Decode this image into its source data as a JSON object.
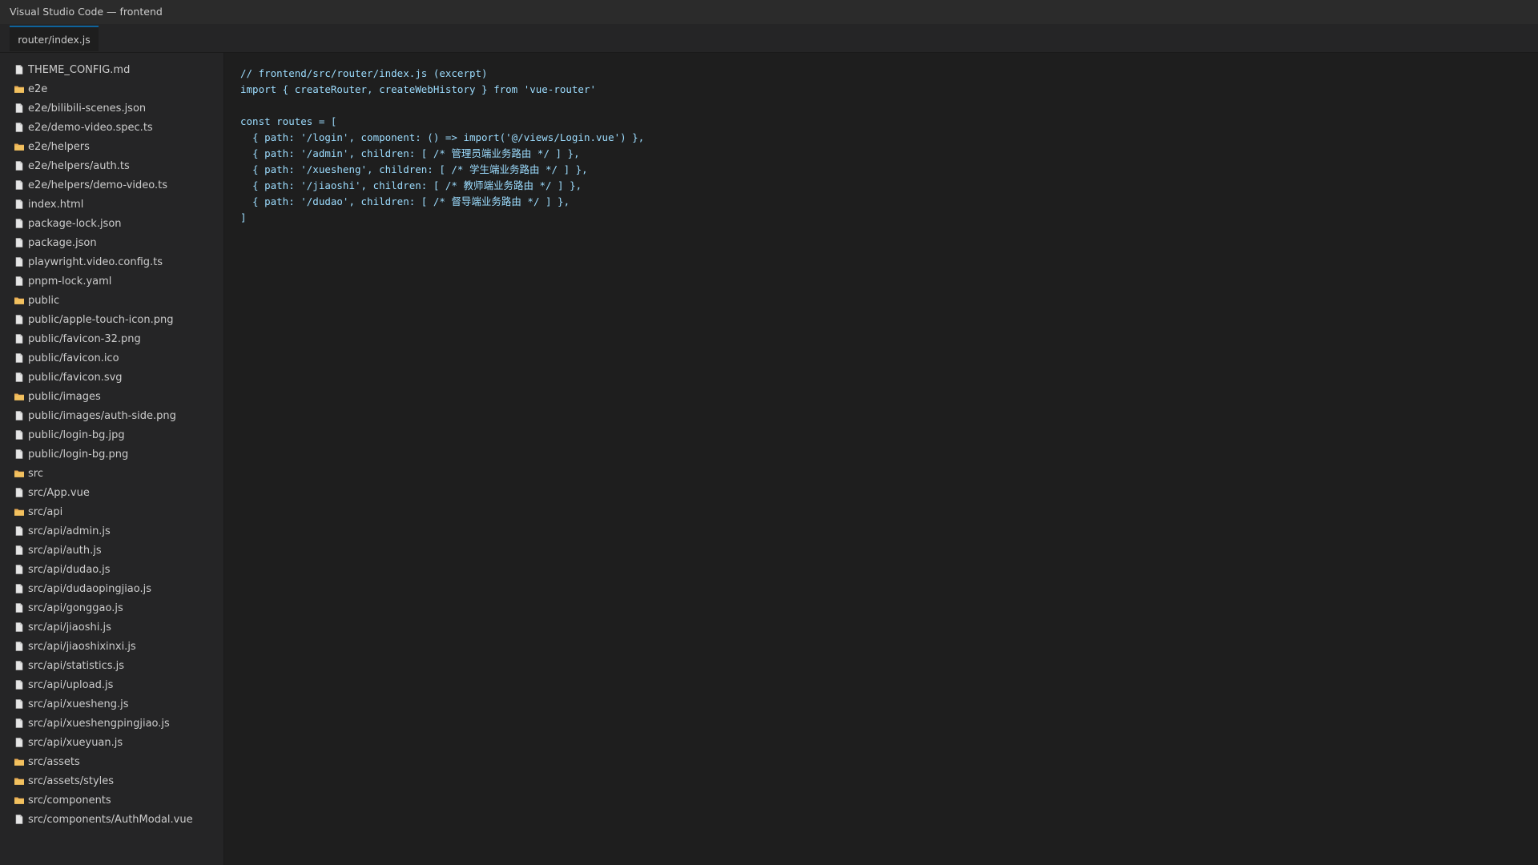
{
  "window": {
    "title": "Visual Studio Code — frontend"
  },
  "tabs": [
    {
      "label": "router/index.js",
      "active": true
    }
  ],
  "explorer": {
    "items": [
      {
        "label": "THEME_CONFIG.md",
        "type": "file"
      },
      {
        "label": "e2e",
        "type": "folder"
      },
      {
        "label": "e2e/bilibili-scenes.json",
        "type": "file"
      },
      {
        "label": "e2e/demo-video.spec.ts",
        "type": "file"
      },
      {
        "label": "e2e/helpers",
        "type": "folder"
      },
      {
        "label": "e2e/helpers/auth.ts",
        "type": "file"
      },
      {
        "label": "e2e/helpers/demo-video.ts",
        "type": "file"
      },
      {
        "label": "index.html",
        "type": "file"
      },
      {
        "label": "package-lock.json",
        "type": "file"
      },
      {
        "label": "package.json",
        "type": "file"
      },
      {
        "label": "playwright.video.config.ts",
        "type": "file"
      },
      {
        "label": "pnpm-lock.yaml",
        "type": "file"
      },
      {
        "label": "public",
        "type": "folder"
      },
      {
        "label": "public/apple-touch-icon.png",
        "type": "file"
      },
      {
        "label": "public/favicon-32.png",
        "type": "file"
      },
      {
        "label": "public/favicon.ico",
        "type": "file"
      },
      {
        "label": "public/favicon.svg",
        "type": "file"
      },
      {
        "label": "public/images",
        "type": "folder"
      },
      {
        "label": "public/images/auth-side.png",
        "type": "file"
      },
      {
        "label": "public/login-bg.jpg",
        "type": "file"
      },
      {
        "label": "public/login-bg.png",
        "type": "file"
      },
      {
        "label": "src",
        "type": "folder"
      },
      {
        "label": "src/App.vue",
        "type": "file"
      },
      {
        "label": "src/api",
        "type": "folder"
      },
      {
        "label": "src/api/admin.js",
        "type": "file"
      },
      {
        "label": "src/api/auth.js",
        "type": "file"
      },
      {
        "label": "src/api/dudao.js",
        "type": "file"
      },
      {
        "label": "src/api/dudaopingjiao.js",
        "type": "file"
      },
      {
        "label": "src/api/gonggao.js",
        "type": "file"
      },
      {
        "label": "src/api/jiaoshi.js",
        "type": "file"
      },
      {
        "label": "src/api/jiaoshixinxi.js",
        "type": "file"
      },
      {
        "label": "src/api/statistics.js",
        "type": "file"
      },
      {
        "label": "src/api/upload.js",
        "type": "file"
      },
      {
        "label": "src/api/xuesheng.js",
        "type": "file"
      },
      {
        "label": "src/api/xueshengpingjiao.js",
        "type": "file"
      },
      {
        "label": "src/api/xueyuan.js",
        "type": "file"
      },
      {
        "label": "src/assets",
        "type": "folder"
      },
      {
        "label": "src/assets/styles",
        "type": "folder"
      },
      {
        "label": "src/components",
        "type": "folder"
      },
      {
        "label": "src/components/AuthModal.vue",
        "type": "file"
      }
    ]
  },
  "editor": {
    "lines": [
      "// frontend/src/router/index.js (excerpt)",
      "import { createRouter, createWebHistory } from 'vue-router'",
      "",
      "const routes = [",
      "  { path: '/login', component: () => import('@/views/Login.vue') },",
      "  { path: '/admin', children: [ /* 管理员端业务路由 */ ] },",
      "  { path: '/xuesheng', children: [ /* 学生端业务路由 */ ] },",
      "  { path: '/jiaoshi', children: [ /* 教师端业务路由 */ ] },",
      "  { path: '/dudao', children: [ /* 督导端业务路由 */ ] },",
      "]"
    ]
  },
  "colors": {
    "background": "#1e1e1e",
    "sidebar": "#252526",
    "titlebar": "#2b2b2b",
    "text": "#cccccc",
    "code": "#9cdcfe",
    "accent": "#0e639c",
    "folder": "#e8ab53"
  },
  "icons": {
    "file": "file-icon",
    "folder": "folder-icon"
  }
}
